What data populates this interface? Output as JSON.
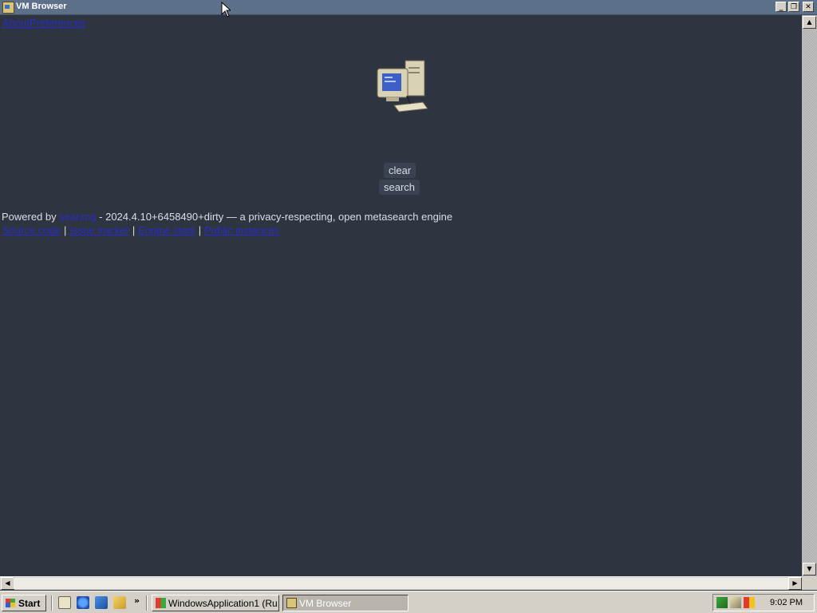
{
  "window": {
    "title": "VM Browser",
    "minimize": "_",
    "restore": "❐",
    "close": "✕"
  },
  "page": {
    "top_links": [
      "About",
      "Preferences"
    ],
    "clear_label": "clear",
    "search_label": "search",
    "footer": {
      "powered_by": "Powered by",
      "project_link": "searxng",
      "version_text": " - 2024.4.10+6458490+dirty — a privacy-respecting, open metasearch engine",
      "links": [
        "Source code",
        "Issue tracker",
        "Engine stats",
        "Public instances"
      ],
      "separator": "|"
    }
  },
  "scrollbars": {
    "up_arrow": "▲",
    "down_arrow": "▼",
    "left_arrow": "◀",
    "right_arrow": "▶"
  },
  "taskbar": {
    "start_label": "Start",
    "chevron": "»",
    "tasks": [
      {
        "label": "WindowsApplication1 (Ru..."
      },
      {
        "label": "VM Browser"
      }
    ],
    "clock": "9:02 PM"
  },
  "colors": {
    "page_bg": "#2e3440",
    "link": "#2a2cc8",
    "text": "#d8dee9",
    "titlebar": "#5d7089"
  }
}
